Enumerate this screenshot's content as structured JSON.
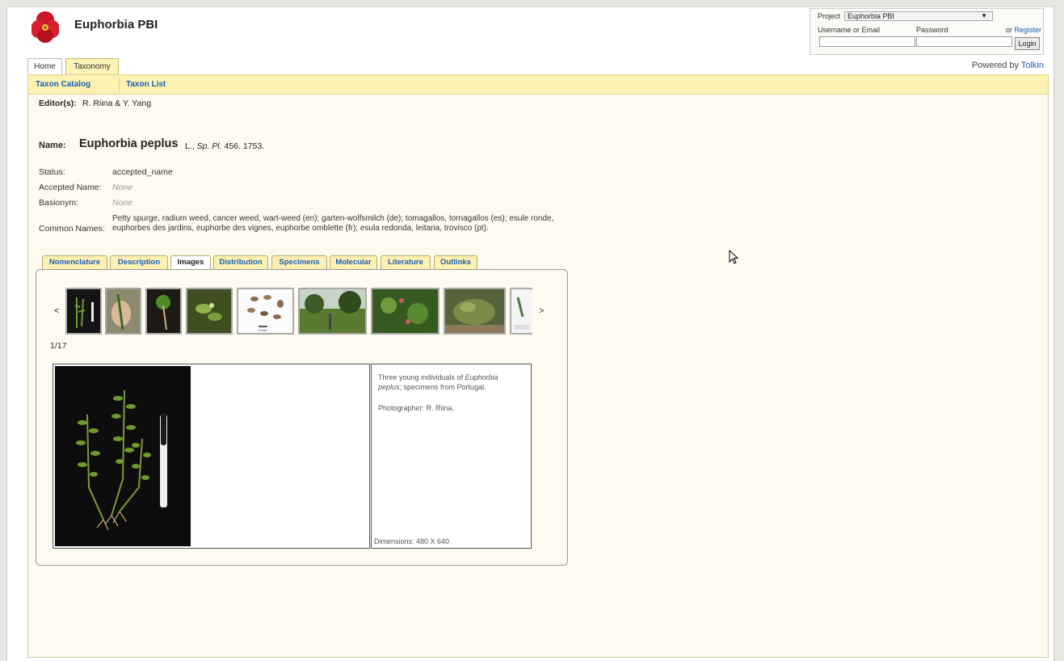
{
  "site": {
    "title": "Euphorbia PBI",
    "logo_icon": "euphorbia-flower-logo"
  },
  "login": {
    "project_label": "Project",
    "project_value": "Euphorbia PBI",
    "username_label": "Username or Email",
    "password_label": "Password",
    "or_text": "or",
    "register_label": "Register",
    "login_button": "Login"
  },
  "tabs": [
    {
      "label": "Home"
    },
    {
      "label": "Taxonomy",
      "active": true
    }
  ],
  "powered_by": {
    "text": "Powered by",
    "link": "Tolkin"
  },
  "subnav": [
    {
      "label": "Taxon Catalog"
    },
    {
      "label": "Taxon List"
    }
  ],
  "editors": {
    "label": "Editor(s):",
    "value": "R. Riina & Y. Yang"
  },
  "taxon": {
    "name_label": "Name:",
    "name": "Euphorbia peplus",
    "author_prefix": "L.,",
    "publication": "Sp. Pl.",
    "citation": "456. 1753."
  },
  "fields": {
    "status": {
      "label": "Status:",
      "value": "accepted_name"
    },
    "accepted": {
      "label": "Accepted Name:",
      "value": "None"
    },
    "basionym": {
      "label": "Basionym:",
      "value": "None"
    },
    "common": {
      "label": "Common Names:",
      "value": "Petty spurge, radium weed, cancer weed, wart-weed (en); garten-wolfsmilch (de); tomagallos, tornagallos (es); esule ronde, euphorbes des jardins, euphorbe des vignes, euphorbe omblette (fr); esula redonda, leitaria, trovisco (pt)."
    }
  },
  "detail_tabs": [
    {
      "label": "Nomenclature"
    },
    {
      "label": "Description"
    },
    {
      "label": "Images",
      "active": true
    },
    {
      "label": "Distribution"
    },
    {
      "label": "Specimens"
    },
    {
      "label": "Molecular"
    },
    {
      "label": "Literature"
    },
    {
      "label": "Outlinks"
    }
  ],
  "gallery": {
    "prev": "<",
    "next": ">",
    "counter": "1/17",
    "caption_pre": "Three young individuals of",
    "caption_species": "Euphorbia peplus",
    "caption_post": "; specimens from Portugal.",
    "photographer": "Photographer: R. Riina.",
    "dimensions": "Dimensions: 480 X 640",
    "scale_label": "1 mm"
  },
  "colors": {
    "accent_yellow": "#fdf2b2",
    "link_blue": "#1a5fb4"
  }
}
